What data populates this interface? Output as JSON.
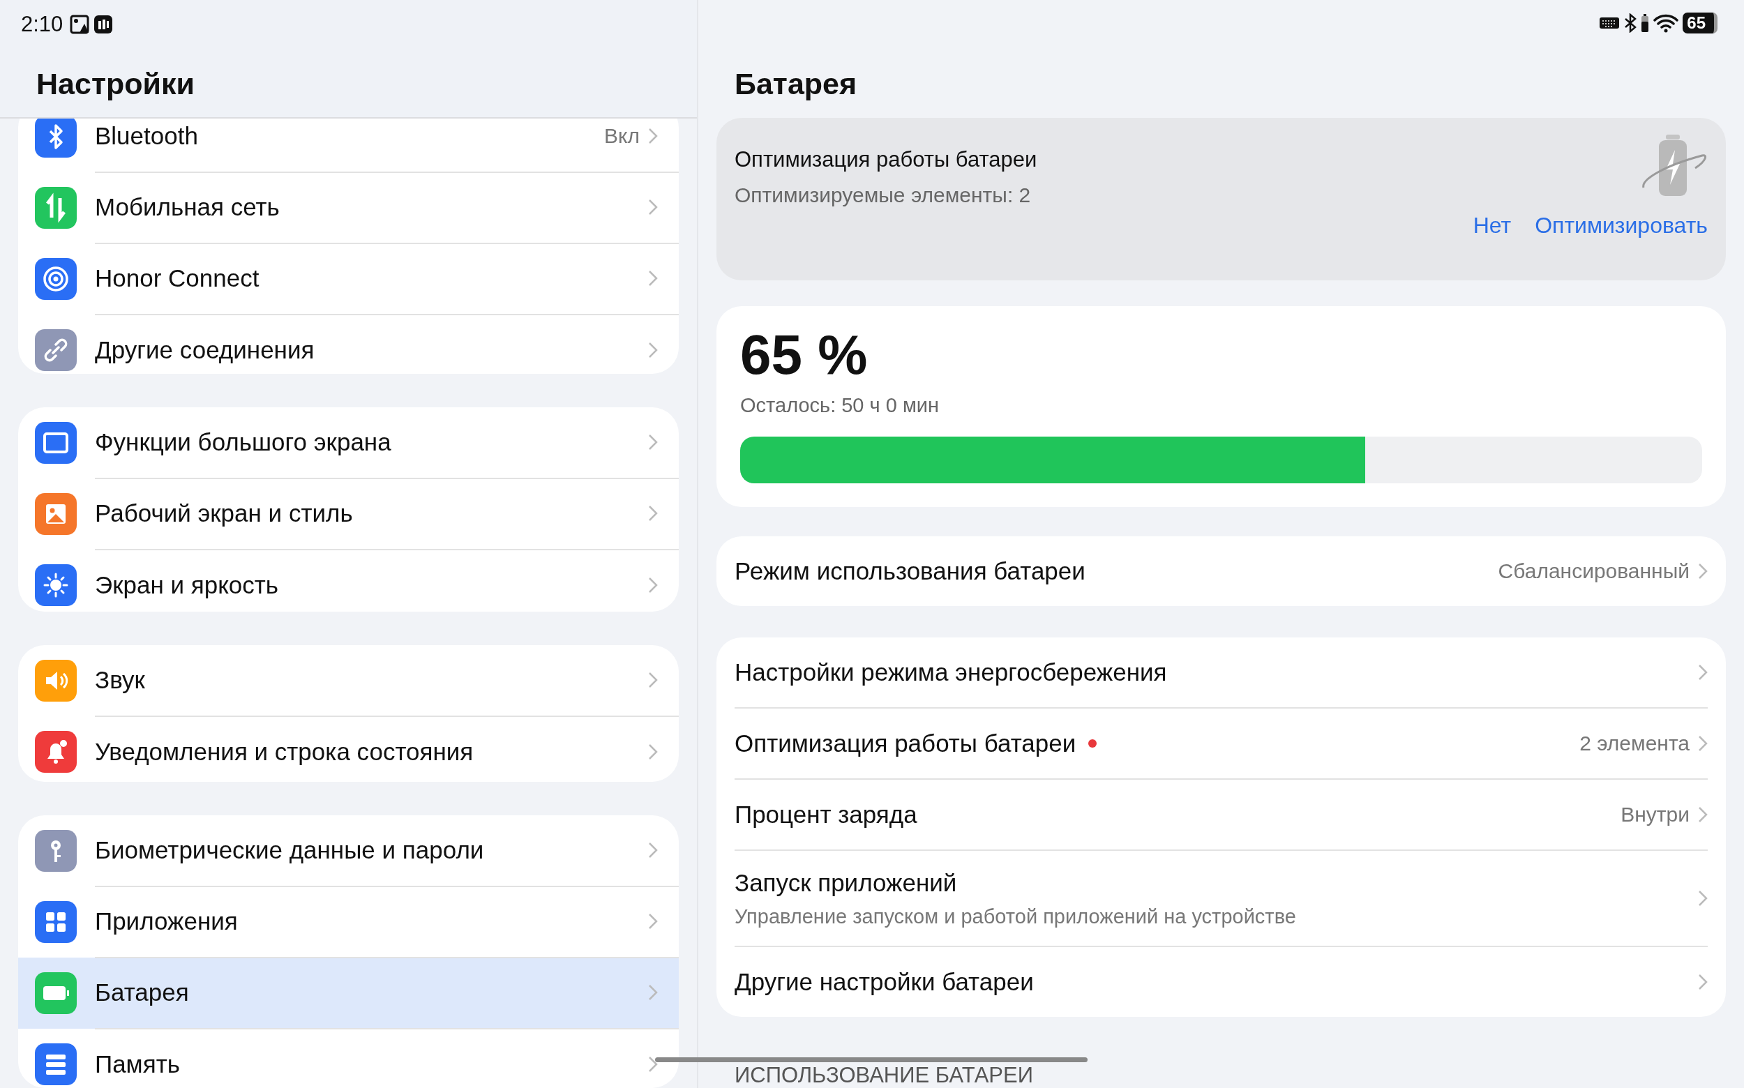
{
  "status_bar": {
    "time": "2:10",
    "battery_text": "65"
  },
  "sidebar": {
    "title": "Настройки",
    "groups": [
      {
        "items": [
          {
            "label": "Bluetooth",
            "value": "Вкл",
            "selected": false
          },
          {
            "label": "Мобильная сеть",
            "selected": false
          },
          {
            "label": "Honor Connect",
            "selected": false
          },
          {
            "label": "Другие соединения",
            "selected": false
          }
        ]
      },
      {
        "items": [
          {
            "label": "Функции большого экрана",
            "selected": false
          },
          {
            "label": "Рабочий экран и стиль",
            "selected": false
          },
          {
            "label": "Экран и яркость",
            "selected": false
          }
        ]
      },
      {
        "items": [
          {
            "label": "Звук",
            "selected": false
          },
          {
            "label": "Уведомления и строка состояния",
            "selected": false
          }
        ]
      },
      {
        "items": [
          {
            "label": "Биометрические данные и пароли",
            "selected": false
          },
          {
            "label": "Приложения",
            "selected": false
          },
          {
            "label": "Батарея",
            "selected": true
          },
          {
            "label": "Память",
            "selected": false
          }
        ]
      }
    ]
  },
  "page": {
    "title": "Батарея",
    "optimization_card": {
      "title": "Оптимизация работы батареи",
      "subtitle": "Оптимизируемые элементы: 2",
      "buttons": [
        "Нет",
        "Оптимизировать"
      ]
    },
    "battery": {
      "percent": "65 %",
      "remaining": "Осталось: 50 ч 0 мин",
      "level": 0.65
    },
    "mode_row": {
      "label": "Режим использования батареи",
      "value": "Сбалансированный"
    },
    "settings": [
      {
        "label": "Настройки режима энергосбережения",
        "dot": false
      },
      {
        "label": "Оптимизация работы батареи",
        "dot": true,
        "value": "2 элемента"
      },
      {
        "label": "Процент заряда",
        "dot": false,
        "value": "Внутри"
      },
      {
        "label": "Запуск приложений",
        "dot": false,
        "subtitle": "Управление запуском и работой приложений на устройстве"
      },
      {
        "label": "Другие настройки батареи",
        "dot": false
      }
    ],
    "section_header": "ИСПОЛЬЗОВАНИЕ БАТАРЕИ"
  }
}
